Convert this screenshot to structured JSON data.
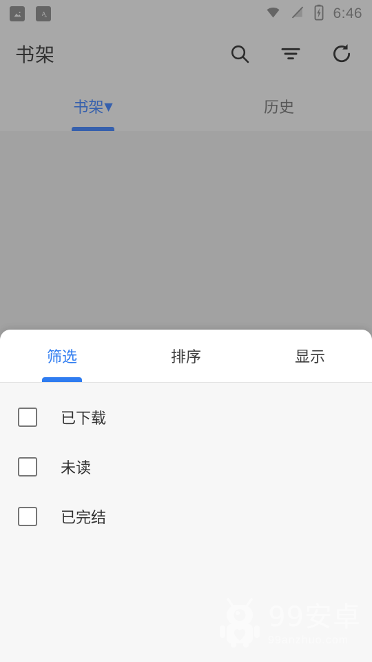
{
  "status_bar": {
    "time": "6:46",
    "notification_icons": [
      {
        "name": "image-notification-icon",
        "glyph": "▲"
      },
      {
        "name": "translate-notification-icon",
        "glyph": "A"
      }
    ],
    "system_icons": [
      {
        "name": "wifi-icon"
      },
      {
        "name": "cellular-signal-off-icon"
      },
      {
        "name": "battery-charging-icon"
      }
    ]
  },
  "toolbar": {
    "title": "书架",
    "actions": [
      {
        "name": "search-icon",
        "label": "搜索"
      },
      {
        "name": "filter-icon",
        "label": "筛选"
      },
      {
        "name": "refresh-icon",
        "label": "刷新"
      }
    ]
  },
  "top_tabs": {
    "items": [
      {
        "label": "书架",
        "caret": "▼",
        "active": true
      },
      {
        "label": "历史",
        "caret": "",
        "active": false
      }
    ]
  },
  "bottom_sheet": {
    "tabs": [
      {
        "label": "筛选",
        "active": true
      },
      {
        "label": "排序",
        "active": false
      },
      {
        "label": "显示",
        "active": false
      }
    ],
    "filters": [
      {
        "label": "已下载",
        "checked": false
      },
      {
        "label": "未读",
        "checked": false
      },
      {
        "label": "已完结",
        "checked": false
      }
    ]
  },
  "watermark": {
    "main": "99安卓",
    "sub": "99anzhuo.com"
  },
  "colors": {
    "accent_blue": "#2f7cf0",
    "tab_blue": "#1a56c4",
    "scrim_gray": "#a8a8a8",
    "sheet_bg": "#f7f7f7",
    "sheet_tabbar_bg": "#ffffff",
    "text_primary": "#303030",
    "checkbox_border": "#767676"
  }
}
